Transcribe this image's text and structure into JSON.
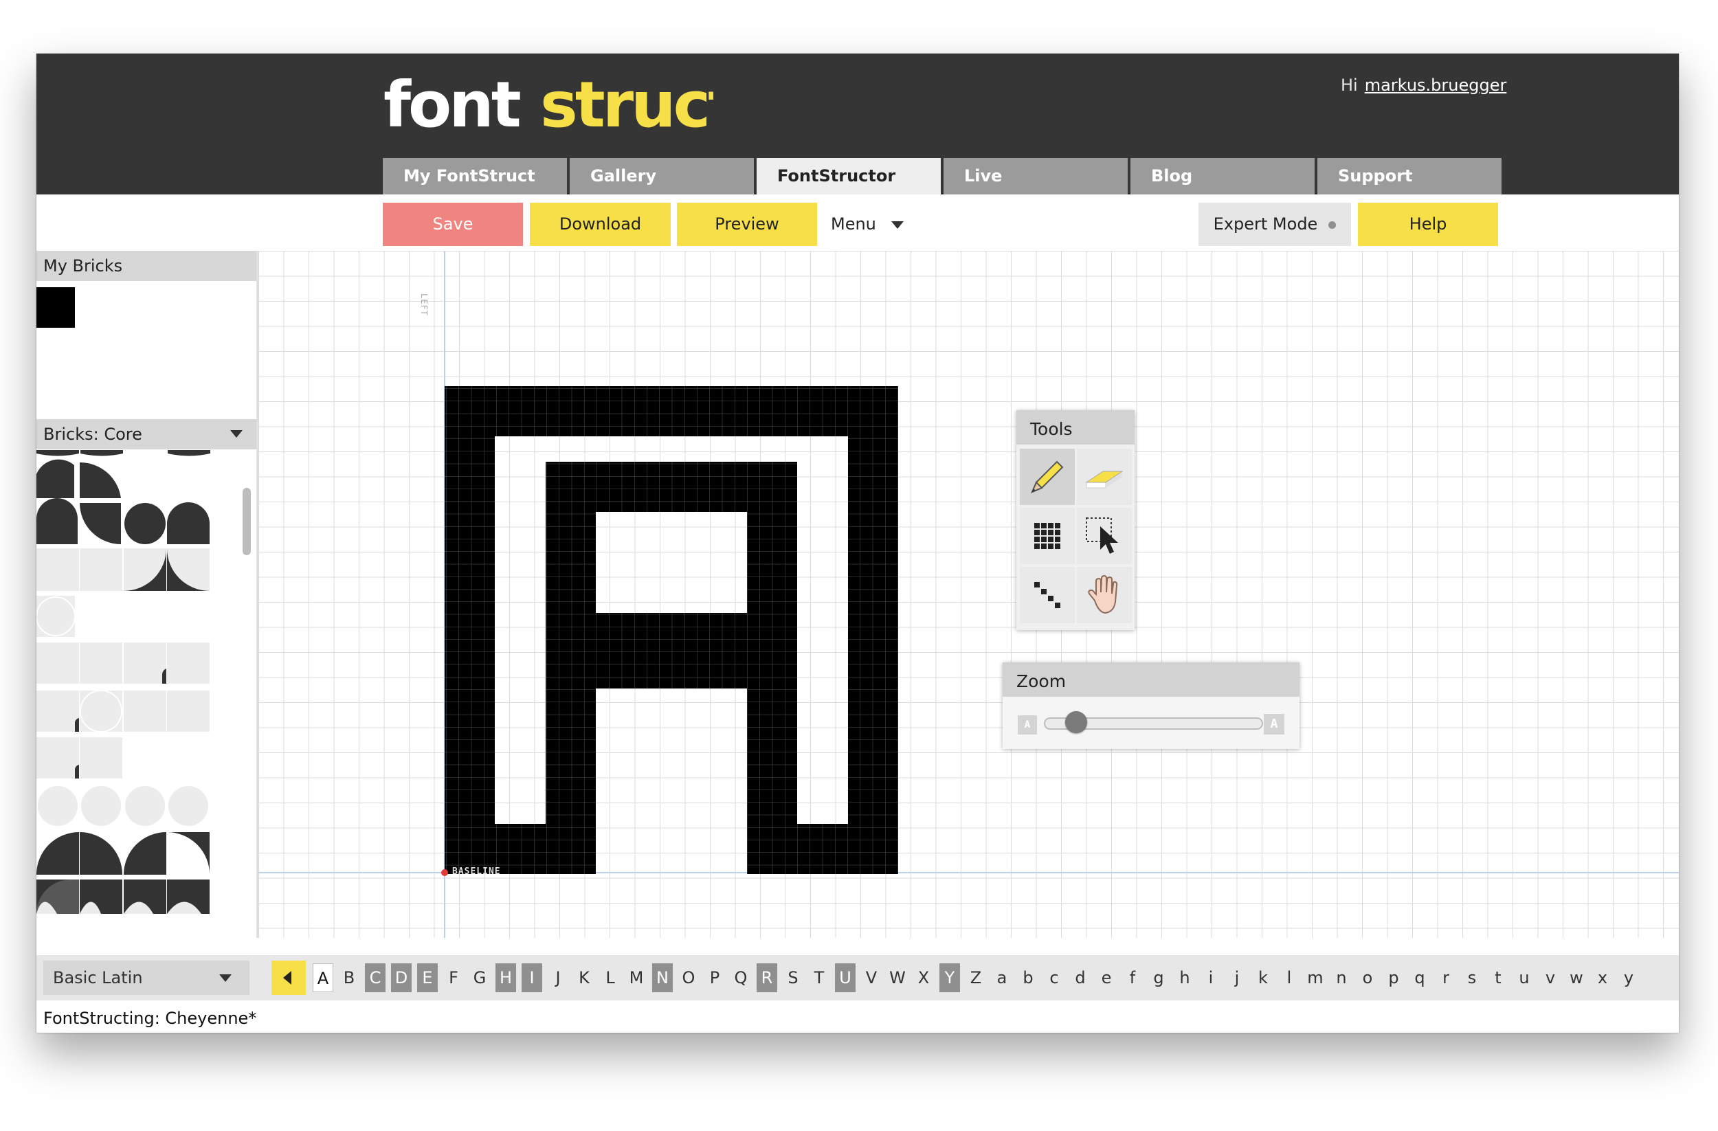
{
  "app": {
    "logo_text_white": "font",
    "logo_text_yellow": "struct",
    "greeting": "Hi",
    "username": "markus.bruegger"
  },
  "nav": {
    "tabs": [
      {
        "label": "My FontStruct",
        "active": false
      },
      {
        "label": "Gallery",
        "active": false
      },
      {
        "label": "FontStructor",
        "active": true
      },
      {
        "label": "Live",
        "active": false
      },
      {
        "label": "Blog",
        "active": false
      },
      {
        "label": "Support",
        "active": false
      }
    ]
  },
  "toolbar": {
    "save_label": "Save",
    "download_label": "Download",
    "preview_label": "Preview",
    "menu_label": "Menu",
    "expert_label": "Expert Mode",
    "help_label": "Help"
  },
  "left_panel": {
    "my_bricks_title": "My Bricks",
    "bricks_core_title": "Bricks: Core"
  },
  "canvas": {
    "left_label": "LEFT",
    "baseline_label": "BASELINE"
  },
  "tools": {
    "title": "Tools",
    "items": [
      "pencil",
      "eraser",
      "fill",
      "select",
      "line",
      "hand"
    ],
    "active": "pencil"
  },
  "zoom": {
    "title": "Zoom",
    "level": 0.1
  },
  "charbar": {
    "charset": "Basic Latin",
    "chars": [
      "A",
      "B",
      "C",
      "D",
      "E",
      "F",
      "G",
      "H",
      "I",
      "J",
      "K",
      "L",
      "M",
      "N",
      "O",
      "P",
      "Q",
      "R",
      "S",
      "T",
      "U",
      "V",
      "W",
      "X",
      "Y",
      "Z",
      "a",
      "b",
      "c",
      "d",
      "e",
      "f",
      "g",
      "h",
      "i",
      "j",
      "k",
      "l",
      "m",
      "n",
      "o",
      "p",
      "q",
      "r",
      "s",
      "t",
      "u",
      "v",
      "w",
      "x",
      "y"
    ],
    "defined": [
      "C",
      "D",
      "E",
      "H",
      "I",
      "N",
      "R",
      "U",
      "Y"
    ],
    "current": "A"
  },
  "status": {
    "text": "FontStructing: Cheyenne*"
  },
  "colors": {
    "header_bg": "#353535",
    "accent_yellow": "#f7df47",
    "save_red": "#ef8481",
    "tab_gray": "#9b9b9b"
  }
}
